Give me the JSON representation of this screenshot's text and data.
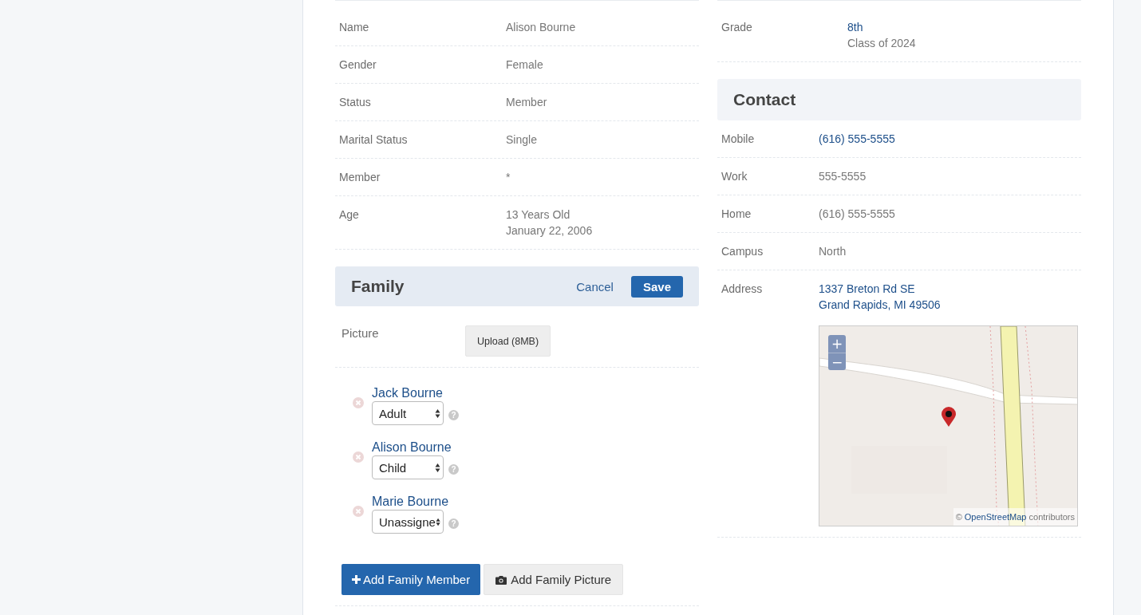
{
  "profile": {
    "rows": [
      {
        "label": "Name",
        "values": [
          {
            "text": "Alison Bourne",
            "link": false
          }
        ]
      },
      {
        "label": "Gender",
        "values": [
          {
            "text": "Female",
            "link": false
          }
        ]
      },
      {
        "label": "Status",
        "values": [
          {
            "text": "Member",
            "link": false
          }
        ]
      },
      {
        "label": "Marital Status",
        "values": [
          {
            "text": "Single",
            "link": false
          }
        ]
      },
      {
        "label": "Member",
        "values": [
          {
            "text": "*",
            "link": false
          }
        ]
      },
      {
        "label": "Age",
        "values": [
          {
            "text": "13 Years Old",
            "link": false
          },
          {
            "text": "January 22, 2006",
            "link": false
          }
        ]
      }
    ]
  },
  "family": {
    "title": "Family",
    "cancel": "Cancel",
    "save": "Save",
    "picture_label": "Picture",
    "upload": "Upload (8MB)",
    "members": [
      {
        "name": "Jack Bourne",
        "role": "Adult",
        "help": "?"
      },
      {
        "name": "Alison Bourne",
        "role": "Child",
        "help": "?"
      },
      {
        "name": "Marie Bourne",
        "role": "Unassigne",
        "help": "?"
      }
    ],
    "add_member": "Add Family Member",
    "add_picture": "Add Family Picture"
  },
  "school": {
    "rows": [
      {
        "label": "Grade",
        "values": [
          {
            "text": "8th",
            "link": true
          },
          {
            "text": "Class of 2024",
            "link": false
          }
        ]
      }
    ]
  },
  "contact": {
    "title": "Contact",
    "rows": [
      {
        "label": "Mobile",
        "values": [
          {
            "text": "(616) 555-5555",
            "link": true
          }
        ]
      },
      {
        "label": "Work",
        "values": [
          {
            "text": "555-5555",
            "link": false
          }
        ]
      },
      {
        "label": "Home",
        "values": [
          {
            "text": "(616) 555-5555",
            "link": false
          }
        ]
      },
      {
        "label": "Campus",
        "values": [
          {
            "text": "North",
            "link": false
          }
        ]
      },
      {
        "label": "Address",
        "values": [
          {
            "text": "1337 Breton Rd SE",
            "link": true
          },
          {
            "text": "Grand Rapids, MI 49506",
            "link": true
          }
        ]
      }
    ],
    "map": {
      "zoom_in": "+",
      "zoom_out": "−",
      "attribution_prefix": "©",
      "attribution_link": "OpenStreetMap",
      "attribution_suffix": "contributors"
    }
  }
}
